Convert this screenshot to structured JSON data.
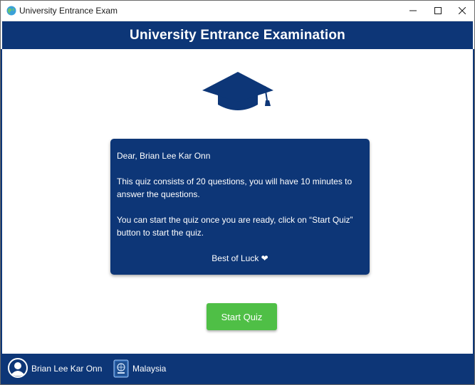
{
  "window": {
    "title": "University Entrance Exam",
    "icon": "globe-icon"
  },
  "header": {
    "title": "University Entrance Examination"
  },
  "hero": {
    "icon": "graduation-cap-icon"
  },
  "card": {
    "greeting": "Dear, Brian Lee Kar Onn",
    "paragraph1": "This quiz consists of 20 questions, you will have 10 minutes to answer the questions.",
    "paragraph2": "You can start the quiz once you are ready, click on “Start Quiz” button to start the quiz.",
    "closing": "Best of Luck ❤"
  },
  "actions": {
    "start_label": "Start Quiz"
  },
  "footer": {
    "user_name": "Brian Lee Kar Onn",
    "user_icon": "user-avatar-icon",
    "country": "Malaysia",
    "country_icon": "passport-icon"
  },
  "colors": {
    "primary": "#0d3677",
    "button": "#4fbf46",
    "text_on_primary": "#ffffff"
  }
}
